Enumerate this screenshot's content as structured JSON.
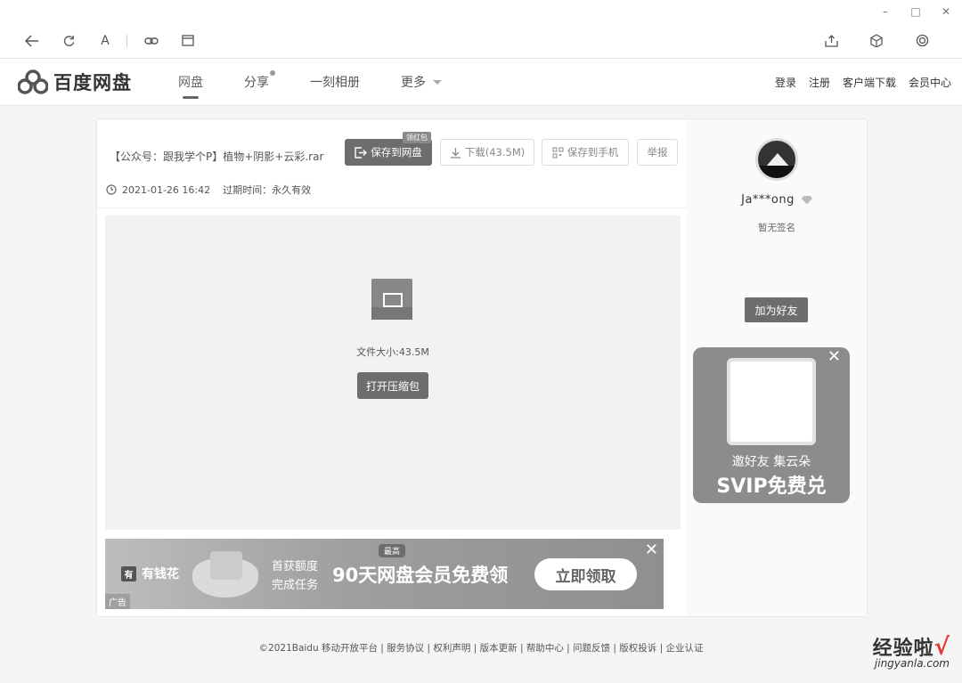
{
  "window": {
    "minimize": "–",
    "maximize": "□",
    "close": "✕"
  },
  "toolbar": {
    "font_button": "A"
  },
  "header": {
    "logo_text": "百度网盘",
    "nav": [
      "网盘",
      "分享",
      "一刻相册",
      "更多"
    ],
    "right_links": [
      "登录",
      "注册",
      "客户端下载",
      "会员中心"
    ]
  },
  "file": {
    "name": "【公众号：跟我学个P】植物+阴影+云彩.rar",
    "date": "2021-01-26 16:42",
    "expire": "过期时间：永久有效",
    "save_button": "保存到网盘",
    "save_badge": "领红包",
    "download_button": "下载(43.5M)",
    "save_phone_button": "保存到手机",
    "report_button": "举报",
    "size_text": "文件大小:43.5M",
    "open_button": "打开压缩包"
  },
  "ad": {
    "brand_box": "有",
    "brand": "有钱花",
    "sub_line1": "首获额度",
    "sub_line2": "完成任务",
    "tag": "最高",
    "main": "90天网盘会员免费领",
    "cta": "立即领取",
    "label": "广告",
    "close": "✕"
  },
  "user": {
    "name": "Ja***ong",
    "signature": "暂无签名",
    "add_friend": "加为好友"
  },
  "promo": {
    "line1": "邀好友 集云朵",
    "line2": "SVIP免费兑",
    "close": "✕"
  },
  "footer": "©2021Baidu 移动开放平台 | 服务协议 | 权利声明 | 版本更新 | 帮助中心 | 问题反馈 | 版权投诉 |   企业认证",
  "watermark": {
    "big": "经验啦",
    "check": "√",
    "small": "jingyanla.com"
  }
}
